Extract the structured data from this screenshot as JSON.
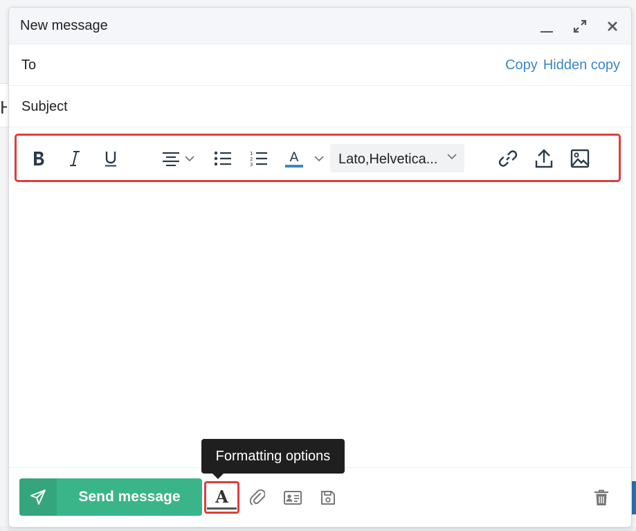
{
  "window": {
    "title": "New message"
  },
  "to": {
    "label": "To",
    "copy_label": "Copy",
    "hidden_copy_label": "Hidden copy"
  },
  "subject": {
    "label": "Subject"
  },
  "toolbar": {
    "buttons": [
      "bold-icon",
      "italic-icon",
      "underline-icon",
      "align-center-icon",
      "bullet-list-icon",
      "numbered-list-icon",
      "text-color-icon",
      "link-icon",
      "upload-icon",
      "image-icon"
    ],
    "font_family": "Lato,Helvetica...",
    "text_color_underline": "#3a86c7",
    "highlight_color": "#e03c3c"
  },
  "footer": {
    "send_label": "Send message",
    "send_color": "#3ab58a",
    "tooltip": "Formatting options",
    "icons": [
      "send-plane-icon",
      "format-text-icon",
      "paperclip-icon",
      "contact-card-icon",
      "save-icon",
      "trash-icon"
    ]
  },
  "colors": {
    "link": "#3a86c7",
    "accent_red": "#e03c3c"
  }
}
